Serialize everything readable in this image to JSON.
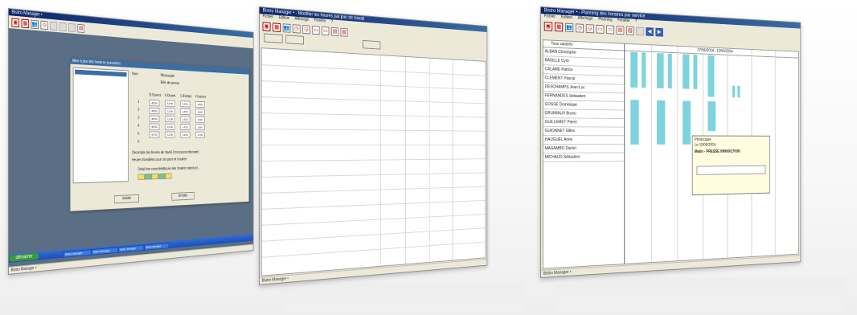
{
  "window1": {
    "title": "Bistro Manager •",
    "dialog": {
      "title": "Mise à jour des horaires journaliers",
      "name_label": "Nom",
      "name_value": "Photocopie",
      "check_label": "Rôle de service",
      "day_numbers": [
        "1",
        "2",
        "3",
        "4",
        "5",
        "6"
      ],
      "col_headers": [
        "D.Ouvert.",
        "F.Ouvert.",
        "D.Fermet.",
        "F.Fermet."
      ],
      "times": [
        [
          "08:00",
          "12:00",
          "14:00",
          "18:00"
        ],
        [
          "08:00",
          "12:00",
          "14:00",
          "18:00"
        ],
        [
          "08:00",
          "12:00",
          "14:00",
          "18:00"
        ],
        [
          "08:00",
          "12:00",
          "14:00",
          "18:00"
        ],
        [
          "07:00",
          "12:00",
          "14:00",
          "17:00"
        ]
      ],
      "text_line_1": "Décompte des heures de travail (hors pause déjeuner)",
      "text_line_2": "Heures travaillées pour ces jours et horaires",
      "text_line_3": "Détail des caractéristiques des horaires standard...",
      "btn_valider": "Valider",
      "btn_annuler": "Annuler"
    },
    "taskbar": {
      "start_label": "démarrer",
      "tasks": [
        "Bistro Manager",
        "Bistro Manager",
        "Bistro Manager",
        "Bistro Manager"
      ]
    },
    "status": "Bistro Manager •"
  },
  "window2": {
    "title": "Bistro Manager • - Modifier les heures par jour de travail",
    "menu": [
      "Fichier",
      "Edition",
      "Affichage",
      "Fenêtre",
      "?"
    ],
    "status": "Bistro Manager •"
  },
  "window3": {
    "title": "Bistro Manager • - Planning des horaires par service",
    "menu": [
      "Fichier",
      "Edition",
      "Affichage",
      "Planning",
      "Fenêtre",
      "?"
    ],
    "list_header": "Tous salariés",
    "date_header": "07/06/2004 - 13/06/2004",
    "employees": [
      "ALBAN Christophe",
      "BASILLE Cyril",
      "CALAME Patrice",
      "CLEMENT Pascal",
      "DESCHAMPS Jean-Luc",
      "FERNANDES Sebastien",
      "GOSSE Dominique",
      "GRUMIAUX Bruno",
      "GUILLEMET Pierre",
      "GUIONNET Gilles",
      "HAUGUEL Anne",
      "MAGAMBO Daniel",
      "MICHAUD Sébastien"
    ],
    "popup": {
      "line1": "Photocopie",
      "line2": "Le 10/06/2004",
      "line3": "Matin - PRESSE 09H00/17H30"
    },
    "status": "Bistro Manager •"
  }
}
